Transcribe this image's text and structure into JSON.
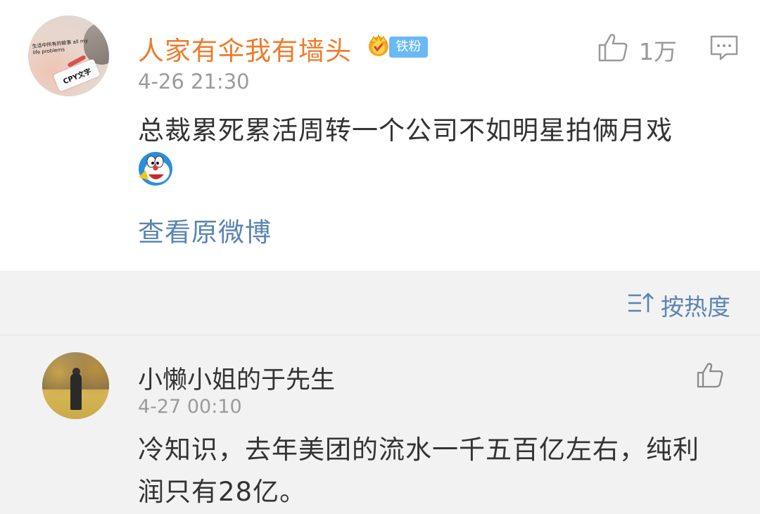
{
  "post": {
    "author": "人家有伞我有墙头",
    "badge": "铁粉",
    "timestamp": "4-26 21:30",
    "text": "总裁累死累活周转一个公司不如明星拍俩月戏",
    "emoji": "doraemon-icon",
    "like_count": "1万",
    "view_original": "查看原微博",
    "avatar_caption": "生活中所有的破事 all my life problems",
    "avatar_tag": "CPY文字"
  },
  "sort": {
    "label": "按热度"
  },
  "comments": [
    {
      "author": "小懒小姐的于先生",
      "timestamp": "4-27 00:10",
      "text": "冷知识，去年美团的流水一千五百亿左右，纯利润只有28亿。"
    }
  ],
  "colors": {
    "username_orange": "#ee7b2b",
    "link_blue": "#5a84b4",
    "badge_blue": "#69b9f5",
    "gray_text": "#9b9b9b",
    "section_bg": "#f2f2f2"
  }
}
